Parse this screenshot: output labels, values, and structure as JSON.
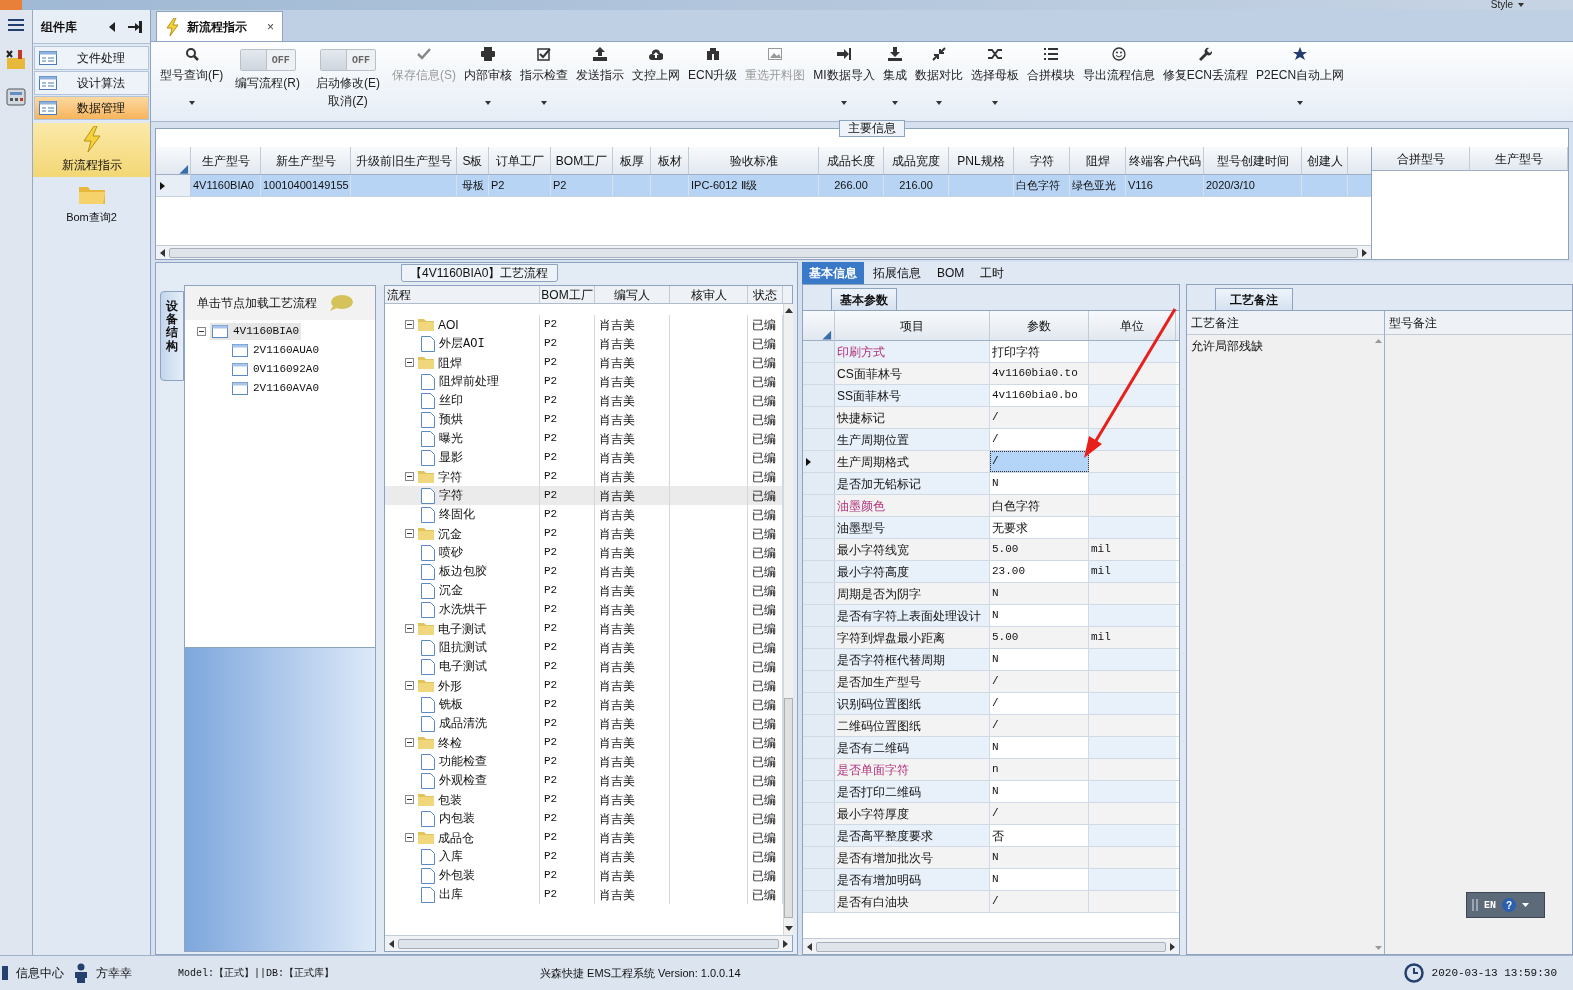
{
  "title_bar": {
    "style_menu": "Style"
  },
  "sidebar": {
    "header": "组件库",
    "items": [
      {
        "label": "文件处理",
        "selected": false
      },
      {
        "label": "设计算法",
        "selected": false
      },
      {
        "label": "数据管理",
        "selected": true
      }
    ],
    "tools": [
      {
        "label": "新流程指示",
        "selected": true
      },
      {
        "label": "Bom查询2",
        "selected": false
      }
    ]
  },
  "document_tab": {
    "label": "新流程指示",
    "close": "×"
  },
  "toolbar": [
    {
      "kind": "button",
      "label": "型号查询(F)",
      "disabled": false,
      "dropdown": true
    },
    {
      "kind": "toggle",
      "switch": "OFF",
      "on": false,
      "label": "编写流程(R)"
    },
    {
      "kind": "toggle",
      "switch": "OFF",
      "on": false,
      "label": "启动修改(E)",
      "sublabel": "取消(Z)"
    },
    {
      "kind": "button",
      "label": "保存信息(S)",
      "disabled": true,
      "dropdown": false
    },
    {
      "kind": "button",
      "label": "内部审核",
      "disabled": false,
      "dropdown": true
    },
    {
      "kind": "button",
      "label": "指示检查",
      "disabled": false,
      "dropdown": true
    },
    {
      "kind": "button",
      "label": "发送指示",
      "disabled": false,
      "dropdown": false
    },
    {
      "kind": "button",
      "label": "文控上网",
      "disabled": false,
      "dropdown": false
    },
    {
      "kind": "button",
      "label": "ECN升级",
      "disabled": false,
      "dropdown": false
    },
    {
      "kind": "button",
      "label": "重选开料图",
      "disabled": true,
      "dropdown": false
    },
    {
      "kind": "button",
      "label": "MI数据导入",
      "disabled": false,
      "dropdown": true
    },
    {
      "kind": "button",
      "label": "集成",
      "disabled": false,
      "dropdown": true
    },
    {
      "kind": "button",
      "label": "数据对比",
      "disabled": false,
      "dropdown": true
    },
    {
      "kind": "button",
      "label": "选择母板",
      "disabled": false,
      "dropdown": true
    },
    {
      "kind": "button",
      "label": "合拼模块",
      "disabled": false,
      "dropdown": false
    },
    {
      "kind": "button",
      "label": "导出流程信息",
      "disabled": false,
      "dropdown": false
    },
    {
      "kind": "button",
      "label": "修复ECN丢流程",
      "disabled": false,
      "dropdown": false
    },
    {
      "kind": "button",
      "label": "P2ECN自动上网",
      "disabled": false,
      "dropdown": true
    }
  ],
  "main_info": {
    "title": "主要信息",
    "columns": [
      "生产型号",
      "新生产型号",
      "升级前旧生产型号",
      "S板",
      "订单工厂",
      "BOM工厂",
      "板厚",
      "板材",
      "验收标准",
      "成品长度",
      "成品宽度",
      "PNL规格",
      "字符",
      "阻焊",
      "终端客户代码",
      "型号创建时间",
      "创建人"
    ],
    "rows": [
      {
        "selected": true,
        "cells": [
          "4V1160BIA0",
          "10010400149155",
          null,
          "母板",
          "P2",
          "P2",
          null,
          null,
          "IPC-6012 Ⅱ级",
          "266.00",
          "216.00",
          null,
          "白色字符",
          "绿色亚光",
          "V116",
          "2020/3/10",
          null
        ]
      }
    ],
    "side_columns": [
      "合拼型号",
      "生产型号"
    ]
  },
  "flow_panel": {
    "title": "【4V1160BIA0】工艺流程",
    "side_tab": "设备结构",
    "tree_header": "单击节点加载工艺流程",
    "tree": [
      {
        "label": "4V1160BIA0",
        "expanded": true,
        "selected": true,
        "children": [
          {
            "label": "2V1160AUA0",
            "selected": false
          },
          {
            "label": "0V116092A0",
            "selected": false
          },
          {
            "label": "2V1160AVA0",
            "selected": false
          }
        ]
      }
    ],
    "grid": {
      "columns": [
        "流程",
        "BOM工厂",
        "编写人",
        "核审人",
        "状态"
      ],
      "rows": [
        {
          "label": "AOI",
          "bom": "P2",
          "writer": "肖吉美",
          "status": "已编",
          "expanded": true,
          "selected": false,
          "children": [
            {
              "label": "外层AOI",
              "bom": "P2",
              "writer": "肖吉美",
              "status": "已编",
              "selected": false
            }
          ]
        },
        {
          "label": "阻焊",
          "bom": "P2",
          "writer": "肖吉美",
          "status": "已编",
          "expanded": true,
          "selected": false,
          "children": [
            {
              "label": "阻焊前处理",
              "bom": "P2",
              "writer": "肖吉美",
              "status": "已编",
              "selected": false
            },
            {
              "label": "丝印",
              "bom": "P2",
              "writer": "肖吉美",
              "status": "已编",
              "selected": false
            },
            {
              "label": "预烘",
              "bom": "P2",
              "writer": "肖吉美",
              "status": "已编",
              "selected": false
            },
            {
              "label": "曝光",
              "bom": "P2",
              "writer": "肖吉美",
              "status": "已编",
              "selected": false
            },
            {
              "label": "显影",
              "bom": "P2",
              "writer": "肖吉美",
              "status": "已编",
              "selected": false
            }
          ]
        },
        {
          "label": "字符",
          "bom": "P2",
          "writer": "肖吉美",
          "status": "已编",
          "expanded": true,
          "selected": false,
          "children": [
            {
              "label": "字符",
              "bom": "P2",
              "writer": "肖吉美",
              "status": "已编",
              "selected": true
            },
            {
              "label": "终固化",
              "bom": "P2",
              "writer": "肖吉美",
              "status": "已编",
              "selected": false
            }
          ]
        },
        {
          "label": "沉金",
          "bom": "P2",
          "writer": "肖吉美",
          "status": "已编",
          "expanded": true,
          "selected": false,
          "children": [
            {
              "label": "喷砂",
              "bom": "P2",
              "writer": "肖吉美",
              "status": "已编",
              "selected": false
            },
            {
              "label": "板边包胶",
              "bom": "P2",
              "writer": "肖吉美",
              "status": "已编",
              "selected": false
            },
            {
              "label": "沉金",
              "bom": "P2",
              "writer": "肖吉美",
              "status": "已编",
              "selected": false
            },
            {
              "label": "水洗烘干",
              "bom": "P2",
              "writer": "肖吉美",
              "status": "已编",
              "selected": false
            }
          ]
        },
        {
          "label": "电子测试",
          "bom": "P2",
          "writer": "肖吉美",
          "status": "已编",
          "expanded": true,
          "selected": false,
          "children": [
            {
              "label": "阻抗测试",
              "bom": "P2",
              "writer": "肖吉美",
              "status": "已编",
              "selected": false
            },
            {
              "label": "电子测试",
              "bom": "P2",
              "writer": "肖吉美",
              "status": "已编",
              "selected": false
            }
          ]
        },
        {
          "label": "外形",
          "bom": "P2",
          "writer": "肖吉美",
          "status": "已编",
          "expanded": true,
          "selected": false,
          "children": [
            {
              "label": "铣板",
              "bom": "P2",
              "writer": "肖吉美",
              "status": "已编",
              "selected": false
            },
            {
              "label": "成品清洗",
              "bom": "P2",
              "writer": "肖吉美",
              "status": "已编",
              "selected": false
            }
          ]
        },
        {
          "label": "终检",
          "bom": "P2",
          "writer": "肖吉美",
          "status": "已编",
          "expanded": true,
          "selected": false,
          "children": [
            {
              "label": "功能检查",
              "bom": "P2",
              "writer": "肖吉美",
              "status": "已编",
              "selected": false
            },
            {
              "label": "外观检查",
              "bom": "P2",
              "writer": "肖吉美",
              "status": "已编",
              "selected": false
            }
          ]
        },
        {
          "label": "包装",
          "bom": "P2",
          "writer": "肖吉美",
          "status": "已编",
          "expanded": true,
          "selected": false,
          "children": [
            {
              "label": "内包装",
              "bom": "P2",
              "writer": "肖吉美",
              "status": "已编",
              "selected": false
            }
          ]
        },
        {
          "label": "成品仓",
          "bom": "P2",
          "writer": "肖吉美",
          "status": "已编",
          "expanded": true,
          "selected": false,
          "children": [
            {
              "label": "入库",
              "bom": "P2",
              "writer": "肖吉美",
              "status": "已编",
              "selected": false
            },
            {
              "label": "外包装",
              "bom": "P2",
              "writer": "肖吉美",
              "status": "已编",
              "selected": false
            },
            {
              "label": "出库",
              "bom": "P2",
              "writer": "肖吉美",
              "status": "已编",
              "selected": false
            }
          ]
        }
      ]
    }
  },
  "detail_tabs": [
    {
      "label": "基本信息",
      "selected": true
    },
    {
      "label": "拓展信息",
      "selected": false
    },
    {
      "label": "BOM",
      "selected": false
    },
    {
      "label": "工时",
      "selected": false
    }
  ],
  "params": {
    "tab": "基本参数",
    "columns": [
      "项目",
      "参数",
      "单位"
    ],
    "rows": [
      {
        "item": "印刷方式",
        "value": "打印字符",
        "flagged": true,
        "selected": false
      },
      {
        "item": "CS面菲林号",
        "value": "4v1160bia0.to",
        "flagged": false,
        "selected": false
      },
      {
        "item": "SS面菲林号",
        "value": "4v1160bia0.bo",
        "flagged": false,
        "selected": false
      },
      {
        "item": "快捷标记",
        "value": "/",
        "flagged": false,
        "selected": false
      },
      {
        "item": "生产周期位置",
        "value": "/",
        "flagged": false,
        "selected": false
      },
      {
        "item": "生产周期格式",
        "value": "/",
        "flagged": false,
        "selected": true
      },
      {
        "item": "是否加无铅标记",
        "value": "N",
        "flagged": false,
        "selected": false
      },
      {
        "item": "油墨颜色",
        "value": "白色字符",
        "flagged": true,
        "selected": false
      },
      {
        "item": "油墨型号",
        "value": "无要求",
        "flagged": false,
        "selected": false
      },
      {
        "item": "最小字符线宽",
        "value": "5.00",
        "unit": "mil",
        "flagged": false,
        "selected": false
      },
      {
        "item": "最小字符高度",
        "value": "23.00",
        "unit": "mil",
        "flagged": false,
        "selected": false
      },
      {
        "item": "周期是否为阴字",
        "value": "N",
        "flagged": false,
        "selected": false
      },
      {
        "item": "是否有字符上表面处理设计",
        "value": "N",
        "flagged": false,
        "selected": false
      },
      {
        "item": "字符到焊盘最小距离",
        "value": "5.00",
        "unit": "mil",
        "flagged": false,
        "selected": false
      },
      {
        "item": "是否字符框代替周期",
        "value": "N",
        "flagged": false,
        "selected": false
      },
      {
        "item": "是否加生产型号",
        "value": "/",
        "flagged": false,
        "selected": false
      },
      {
        "item": "识别码位置图纸",
        "value": "/",
        "flagged": false,
        "selected": false
      },
      {
        "item": "二维码位置图纸",
        "value": "/",
        "flagged": false,
        "selected": false
      },
      {
        "item": "是否有二维码",
        "value": "N",
        "flagged": false,
        "selected": false
      },
      {
        "item": "是否单面字符",
        "value": "n",
        "flagged": true,
        "selected": false
      },
      {
        "item": "是否打印二维码",
        "value": "N",
        "flagged": false,
        "selected": false
      },
      {
        "item": "最小字符厚度",
        "value": "/",
        "flagged": false,
        "selected": false
      },
      {
        "item": "是否高平整度要求",
        "value": "否",
        "flagged": false,
        "selected": false
      },
      {
        "item": "是否有增加批次号",
        "value": "N",
        "flagged": false,
        "selected": false
      },
      {
        "item": "是否有增加明码",
        "value": "N",
        "flagged": false,
        "selected": false
      },
      {
        "item": "是否有白油块",
        "value": "/",
        "flagged": false,
        "selected": false
      }
    ]
  },
  "notes": {
    "tab": "工艺备注",
    "columns": [
      "工艺备注",
      "型号备注"
    ],
    "process_note": "允许局部残缺"
  },
  "ime": {
    "lang": "EN",
    "help": "?"
  },
  "status_bar": {
    "info": "信息中心",
    "user": "方幸幸",
    "db": "Model:【正式】||DB:【正式库】",
    "app": "兴森快捷 EMS工程系统 Version: 1.0.0.14",
    "time": "2020-03-13 13:59:30"
  }
}
